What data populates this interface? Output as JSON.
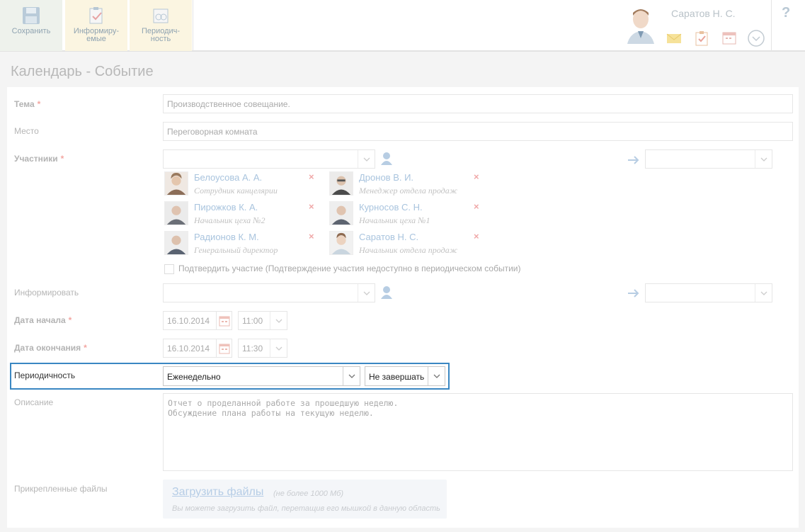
{
  "toolbar": {
    "save_label": "Сохранить",
    "inform_label_1": "Информиру-",
    "inform_label_2": "емые",
    "period_label_1": "Периодич-",
    "period_label_2": "ность"
  },
  "user": {
    "name": "Саратов Н. С.",
    "icons": [
      "mail-icon",
      "tasks-icon",
      "calendar-icon",
      "chevron-down-icon"
    ]
  },
  "help": "?",
  "page_title": "Календарь - Событие",
  "form": {
    "subject": {
      "label": "Тема",
      "required": "*",
      "value": "Производственное совещание."
    },
    "place": {
      "label": "Место",
      "value": "Переговорная комната"
    },
    "participants": {
      "label": "Участники",
      "required": "*",
      "list": [
        {
          "name": "Белоусова А. А.",
          "role": "Сотрудник канцелярии"
        },
        {
          "name": "Дронов В. И.",
          "role": "Менеджер отдела продаж"
        },
        {
          "name": "Пирожков К. А.",
          "role": "Начальник цеха №2"
        },
        {
          "name": "Курносов С. Н.",
          "role": "Начальник цеха №1"
        },
        {
          "name": "Радионов К. М.",
          "role": "Генеральный директор"
        },
        {
          "name": "Саратов Н. С.",
          "role": "Начальник отдела продаж"
        }
      ],
      "remove_glyph": "×",
      "confirm_label": "Подтвердить участие (Подтверждение участия недоступно в периодическом событии)"
    },
    "inform": {
      "label": "Информировать"
    },
    "start": {
      "label": "Дата начала",
      "required": "*",
      "date": "16.10.2014",
      "time": "11:00"
    },
    "end": {
      "label": "Дата окончания",
      "required": "*",
      "date": "16.10.2014",
      "time": "11:30"
    },
    "periodicity": {
      "label": "Периодичность",
      "value": "Еженедельно",
      "end_value": "Не завершать"
    },
    "description": {
      "label": "Описание",
      "line1": "Отчет о проделанной работе за прошедшую неделю.",
      "line2": "Обсуждение плана работы на текущую неделю."
    },
    "attachments": {
      "label": "Прикрепленные файлы",
      "upload_link": "Загрузить файлы",
      "limit": "(не более 1000 Мб)",
      "hint": "Вы можете загрузить файл, перетащив его мышкой в данную область"
    }
  }
}
